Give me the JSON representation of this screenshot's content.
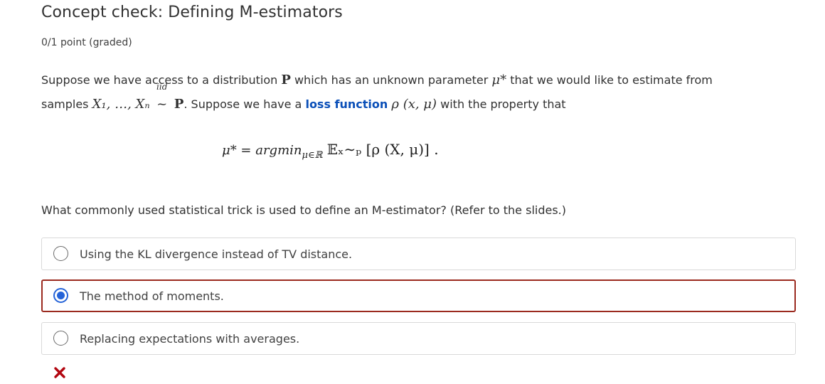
{
  "problem": {
    "title": "Concept check: Defining M-estimators",
    "points": "0/1 point (graded)"
  },
  "body": {
    "text1": "Suppose we have access to a distribution ",
    "text2": " which has an unknown parameter ",
    "text3": " that we would like to estimate from",
    "text4": "samples ",
    "text5": ". Suppose we have a ",
    "link_term": "loss function",
    "text6": " with the property that",
    "math_P": "P",
    "math_mu_star": "μ*",
    "math_samples": "X₁, …, Xₙ",
    "math_iid": "iid",
    "math_tilde": "~",
    "math_loss": "ρ (x, μ)",
    "display_equation": "μ* = argmin",
    "display_sub": "μ∈ℝ",
    "display_rest": " 𝔼ₓ∼ₚ [ρ (X, μ)] ."
  },
  "question": "What commonly used statistical trick is used to define an M-estimator? (Refer to the slides.)",
  "choices": [
    {
      "label": "Using the KL divergence instead of TV distance.",
      "selected": false
    },
    {
      "label": "The method of moments.",
      "selected": true
    },
    {
      "label": "Replacing expectations with averages.",
      "selected": false
    }
  ],
  "result": {
    "status": "incorrect",
    "icon": "cross-icon",
    "color": "#b20610"
  },
  "colors": {
    "accent": "#2563d8",
    "selected_border": "#9b2a1f",
    "link": "#0a4fb8"
  }
}
